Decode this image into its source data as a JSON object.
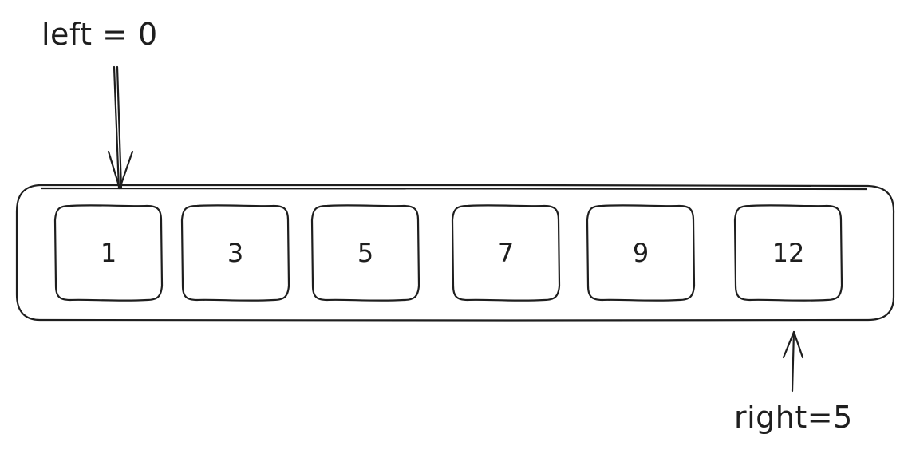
{
  "diagram": {
    "array": {
      "values": [
        "1",
        "3",
        "5",
        "7",
        "9",
        "12"
      ]
    },
    "pointers": {
      "left": {
        "label": "left = 0",
        "index": 0
      },
      "right": {
        "label": "right=5",
        "index": 5
      }
    }
  }
}
